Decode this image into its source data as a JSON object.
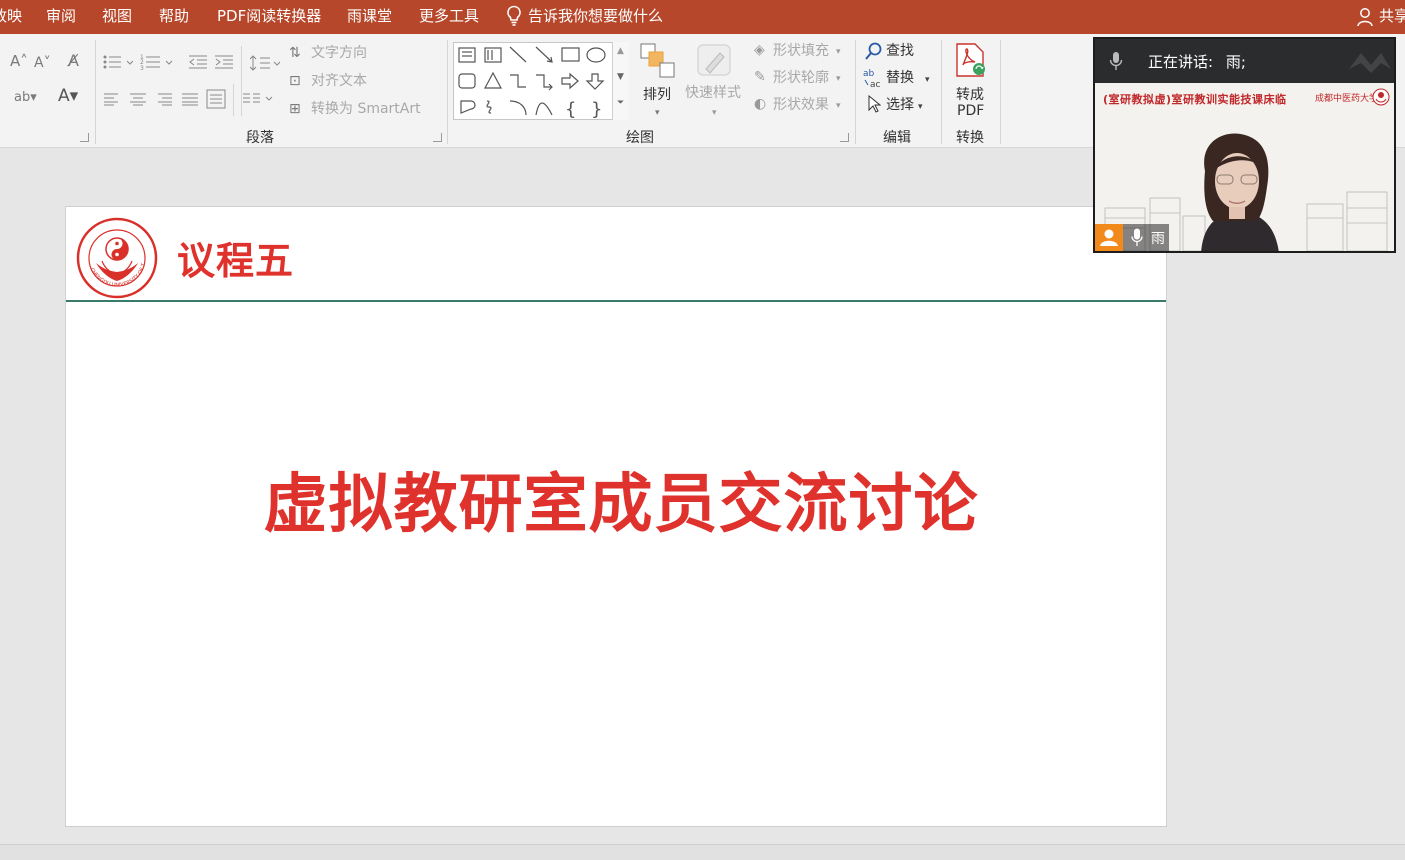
{
  "menu": {
    "tabs": [
      "放映",
      "审阅",
      "视图",
      "帮助",
      "PDF阅读转换器",
      "雨课堂",
      "更多工具"
    ],
    "tell_me": "告诉我你想要做什么",
    "share": "共享"
  },
  "ribbon": {
    "paragraph": {
      "label": "段落",
      "text_direction": "文字方向",
      "align_text": "对齐文本",
      "convert_smartart": "转换为 SmartArt"
    },
    "drawing": {
      "label": "绘图",
      "arrange": "排列",
      "quick_styles": "快速样式",
      "shape_fill": "形状填充",
      "shape_outline": "形状轮廓",
      "shape_effects": "形状效果"
    },
    "editing": {
      "label": "编辑",
      "find": "查找",
      "replace": "替换",
      "select": "选择"
    },
    "convert": {
      "label": "转换",
      "to_pdf_line1": "转成",
      "to_pdf_line2": "PDF"
    }
  },
  "slide": {
    "header_title": "议程五",
    "main_title": "虚拟教研室成员交流讨论",
    "logo_text": "CHENGDU UNIVERSITY OF T.C.M"
  },
  "video_call": {
    "speaking_label": "正在讲话:",
    "speaker_name": "雨;",
    "participant_name": "雨",
    "banner_text": "(室研教拟虚)室研教训实能技课床临",
    "banner_logo_text": "成都中医药大学"
  },
  "colors": {
    "menu_bar": "#b7472a",
    "accent_red": "#e0322d",
    "rule_green": "#3a7a6a",
    "avatar_orange": "#f18a1b"
  }
}
